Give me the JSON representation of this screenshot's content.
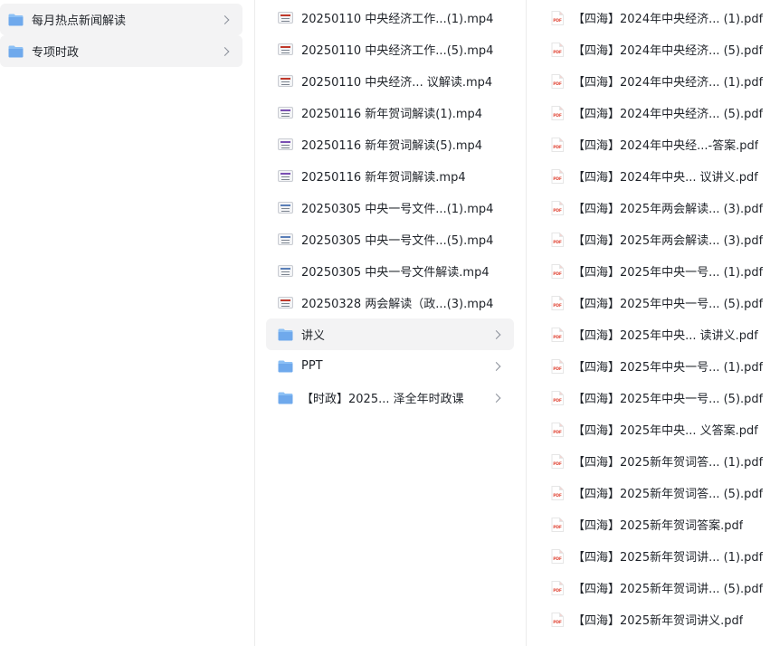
{
  "col1": {
    "items": [
      {
        "label": "每月热点新闻解读"
      },
      {
        "label": "专项时政"
      }
    ]
  },
  "col2": {
    "files": [
      {
        "label": "20250110 中央经济工作...(1).mp4",
        "thumb": "t1"
      },
      {
        "label": "20250110 中央经济工作...(5).mp4",
        "thumb": "t1"
      },
      {
        "label": "20250110 中央经济... 议解读.mp4",
        "thumb": "t1"
      },
      {
        "label": "20250116 新年贺词解读(1).mp4",
        "thumb": "t2"
      },
      {
        "label": "20250116 新年贺词解读(5).mp4",
        "thumb": "t2"
      },
      {
        "label": "20250116 新年贺词解读.mp4",
        "thumb": "t2"
      },
      {
        "label": "20250305 中央一号文件...(1).mp4",
        "thumb": "t3"
      },
      {
        "label": "20250305 中央一号文件...(5).mp4",
        "thumb": "t3"
      },
      {
        "label": "20250305 中央一号文件解读.mp4",
        "thumb": "t3"
      },
      {
        "label": "20250328 两会解读（政...(3).mp4",
        "thumb": "t4"
      }
    ],
    "folders": [
      {
        "label": "讲义",
        "selected": true
      },
      {
        "label": "PPT",
        "selected": false
      },
      {
        "label": "【时政】2025...  泽全年时政课",
        "selected": false
      }
    ]
  },
  "col3": {
    "files": [
      {
        "label": "【四海】2024年中央经济... (1).pdf"
      },
      {
        "label": "【四海】2024年中央经济... (5).pdf"
      },
      {
        "label": "【四海】2024年中央经济... (1).pdf"
      },
      {
        "label": "【四海】2024年中央经济... (5).pdf"
      },
      {
        "label": "【四海】2024年中央经...-答案.pdf"
      },
      {
        "label": "【四海】2024年中央...  议讲义.pdf"
      },
      {
        "label": "【四海】2025年两会解读... (3).pdf"
      },
      {
        "label": "【四海】2025年两会解读... (3).pdf"
      },
      {
        "label": "【四海】2025年中央一号... (1).pdf"
      },
      {
        "label": "【四海】2025年中央一号... (5).pdf"
      },
      {
        "label": "【四海】2025年中央...  读讲义.pdf"
      },
      {
        "label": "【四海】2025年中央一号... (1).pdf"
      },
      {
        "label": "【四海】2025年中央一号... (5).pdf"
      },
      {
        "label": "【四海】2025年中央...  义答案.pdf"
      },
      {
        "label": "【四海】2025新年贺词答... (1).pdf"
      },
      {
        "label": "【四海】2025新年贺词答... (5).pdf"
      },
      {
        "label": "【四海】2025新年贺词答案.pdf"
      },
      {
        "label": "【四海】2025新年贺词讲... (1).pdf"
      },
      {
        "label": "【四海】2025新年贺词讲... (5).pdf"
      },
      {
        "label": "【四海】2025新年贺词讲义.pdf"
      }
    ],
    "pdf_badge": "PDF"
  },
  "icons": {
    "folder": "folder-icon",
    "video": "video-thumbnail-icon",
    "pdf": "pdf-file-icon",
    "chevron": "chevron-right-icon"
  },
  "colors": {
    "folder": "#7cb6f2",
    "selected_bg": "#f3f3f4",
    "pdf_red": "#e14b3b"
  }
}
